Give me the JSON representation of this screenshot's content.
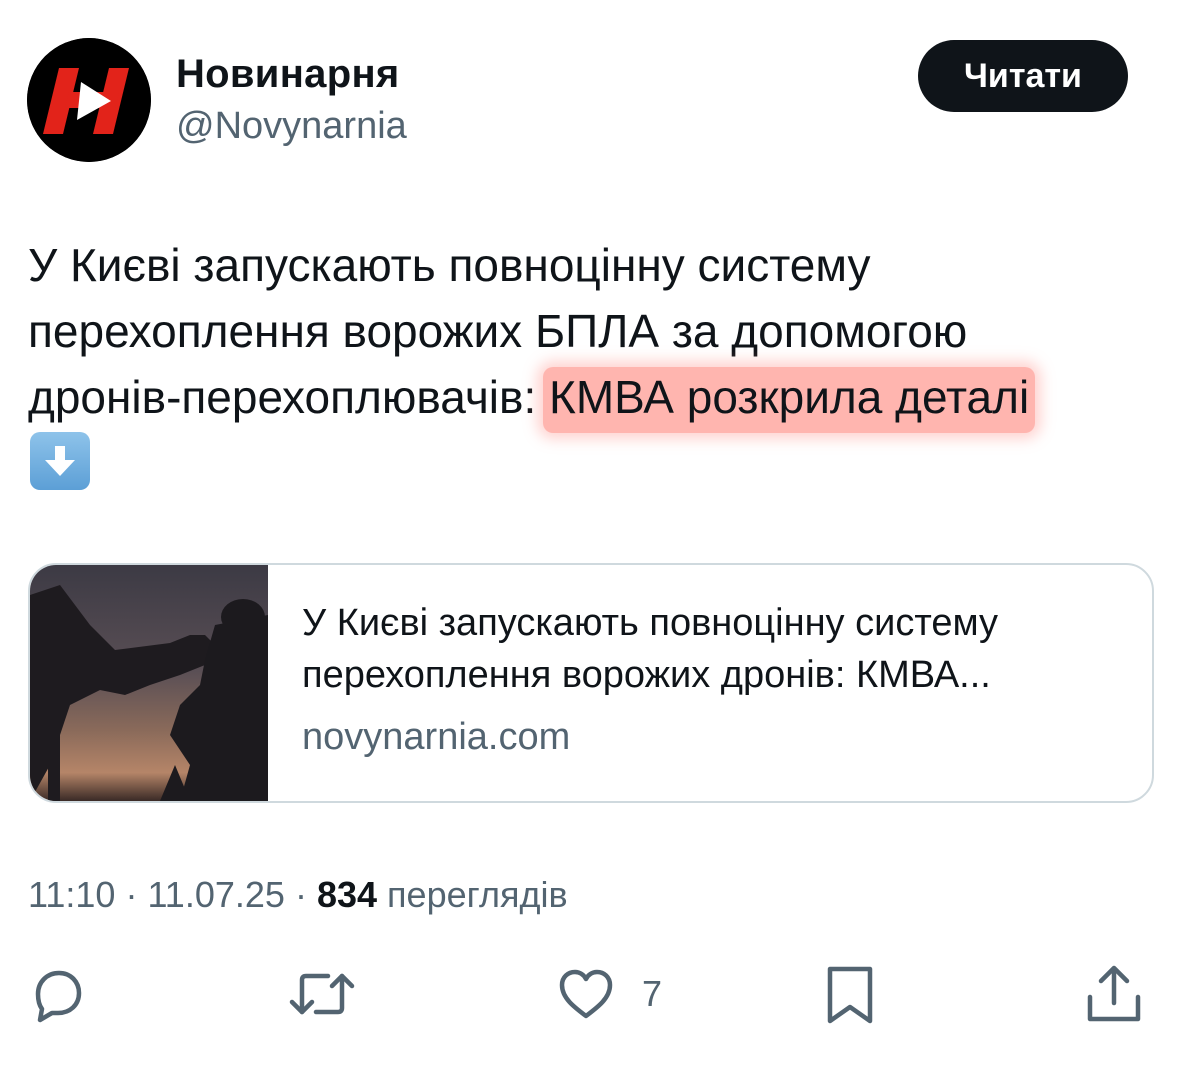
{
  "account": {
    "display_name": "Новинарня",
    "handle": "@Novynarnia",
    "avatar_icon": "novynarnia-logo-icon"
  },
  "header": {
    "read_button_label": "Читати"
  },
  "tweet": {
    "text_lines": [
      "У Києві запускають повноцінну систему",
      "перехоплення ворожих БПЛА за допомогою",
      "дронів-перехоплювачів: "
    ],
    "highlighted_text": "КМВА розкрила деталі",
    "emoji": "down-arrow-emoji-icon",
    "highlight_color": "#ff786e"
  },
  "link_card": {
    "title_lines": [
      "У Києві запускають повноцінну систему",
      "перехоплення ворожих дронів: КМВА..."
    ],
    "domain": "novynarnia.com",
    "image_icon": "soldier-silhouette-image"
  },
  "meta": {
    "time": "11:10",
    "separator": "·",
    "date": "11.07.25",
    "views_count": "834",
    "views_label": "переглядів"
  },
  "actions": {
    "like_count": "7",
    "icons": [
      "reply-icon",
      "retweet-icon",
      "like-icon",
      "bookmark-icon",
      "share-icon"
    ]
  },
  "colors": {
    "text": "#0f1419",
    "secondary": "#536471",
    "button_bg": "#0f1419",
    "border": "#cfd9de"
  }
}
